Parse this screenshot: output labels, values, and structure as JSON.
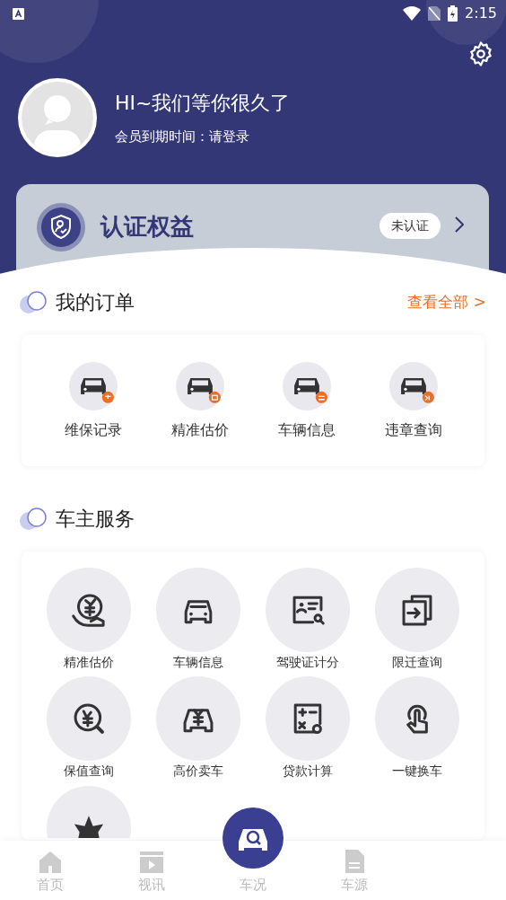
{
  "status_bar": {
    "time": "2:15"
  },
  "profile": {
    "greeting": "HI~我们等你很久了",
    "membership": "会员到期时间：请登录"
  },
  "certification": {
    "title": "认证权益",
    "status": "未认证",
    "certified": false
  },
  "orders": {
    "title": "我的订单",
    "view_all": "查看全部 >",
    "items": [
      {
        "label": "维保记录",
        "kind": "repair"
      },
      {
        "label": "精准估价",
        "kind": "estimate"
      },
      {
        "label": "车辆信息",
        "kind": "info"
      },
      {
        "label": "违章查询",
        "kind": "violation"
      }
    ]
  },
  "services": {
    "title": "车主服务",
    "items": [
      {
        "label": "精准估价",
        "kind": "yuan-hand"
      },
      {
        "label": "车辆信息",
        "kind": "car"
      },
      {
        "label": "驾驶证计分",
        "kind": "license"
      },
      {
        "label": "限迁查询",
        "kind": "transfer"
      },
      {
        "label": "保值查询",
        "kind": "yuan-search"
      },
      {
        "label": "高价卖车",
        "kind": "car-yuan"
      },
      {
        "label": "贷款计算",
        "kind": "calculator"
      },
      {
        "label": "一键换车",
        "kind": "tap"
      },
      {
        "kind": "star"
      }
    ]
  },
  "tab_bar": [
    {
      "label": "首页",
      "kind": "home",
      "selected": false
    },
    {
      "label": "视讯",
      "kind": "video",
      "selected": false
    },
    {
      "label": "车况",
      "kind": "center",
      "selected": false
    },
    {
      "label": "车源",
      "kind": "doc",
      "selected": false
    }
  ]
}
